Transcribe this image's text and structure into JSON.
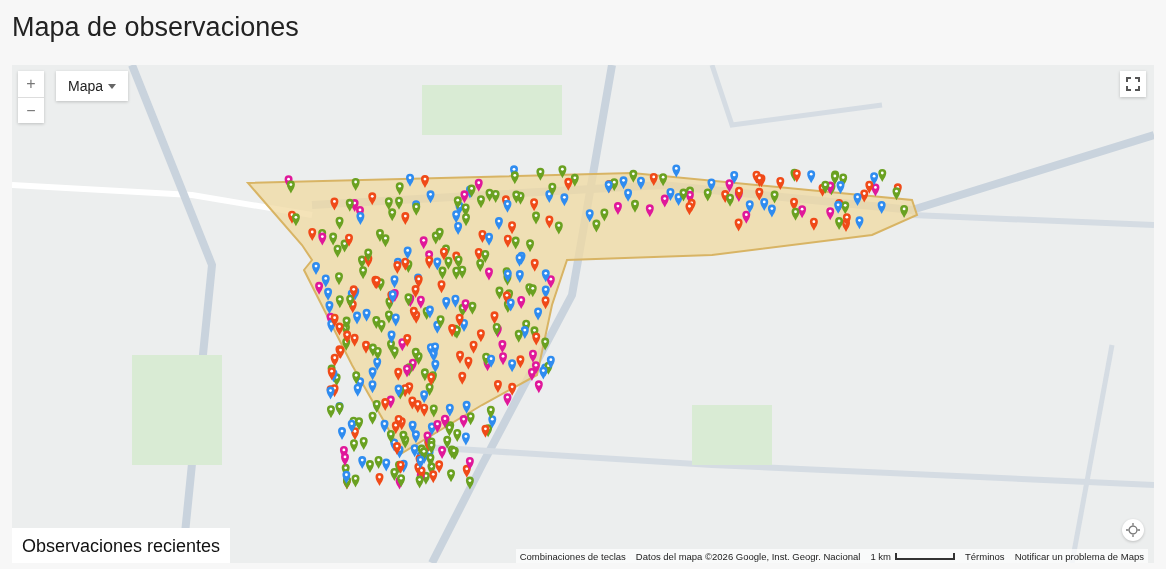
{
  "page_title": "Mapa de observaciones",
  "map": {
    "zoom_in": "+",
    "zoom_out": "−",
    "map_type": "Mapa",
    "shortcuts": "Combinaciones de teclas",
    "attribution": "Datos del mapa ©2026 Google, Inst. Geogr. Nacional",
    "scale": "1 km",
    "terms": "Términos",
    "report": "Notificar un problema de Maps"
  },
  "section_title": "Observaciones recientes"
}
